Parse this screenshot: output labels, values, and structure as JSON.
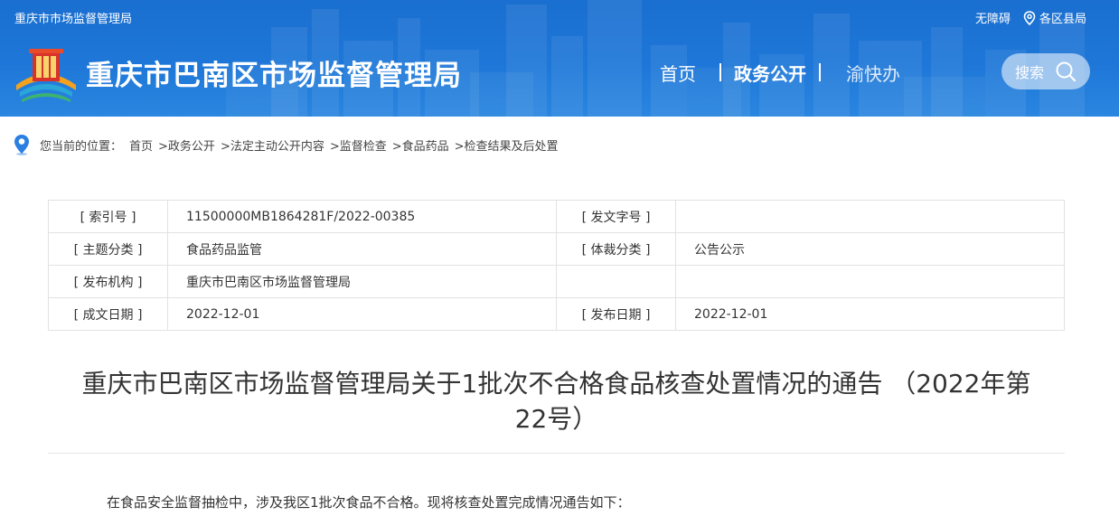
{
  "header": {
    "org_name": "重庆市市场监督管理局",
    "accessibility": "无障碍",
    "district_bureaus": "各区县局",
    "site_title": "重庆市巴南区市场监督管理局",
    "nav": [
      {
        "label": "首页"
      },
      {
        "label": "政务公开"
      },
      {
        "label": "渝快办"
      }
    ],
    "search_label": "搜索",
    "colors": {
      "header_bg": "#1e77d8",
      "text": "#ffffff"
    }
  },
  "breadcrumb": {
    "label": "您当前的位置：",
    "items": [
      "首页",
      ">政务公开",
      ">法定主动公开内容",
      ">监督检查",
      ">食品药品",
      ">检查结果及后处置"
    ]
  },
  "info": {
    "index_key": "[ 索引号 ]",
    "index_value": "11500000MB1864281F/2022-00385",
    "doc_no_key": "[ 发文字号 ]",
    "doc_no_value": "",
    "topic_key": "[ 主题分类 ]",
    "topic_value": "食品药品监管",
    "genre_key": "[ 体裁分类 ]",
    "genre_value": "公告公示",
    "publisher_key": "[ 发布机构 ]",
    "publisher_value": "重庆市巴南区市场监督管理局",
    "created_key": "[ 成文日期 ]",
    "created_value": "2022-12-01",
    "published_key": "[ 发布日期 ]",
    "published_value": "2022-12-01"
  },
  "article": {
    "title_line1": "重庆市巴南区市场监督管理局关于1批次不合格食品核查处置情况的通告 （2022年第",
    "title_line2": "22号）",
    "first_paragraph": "在食品安全监督抽检中，涉及我区1批次食品不合格。现将核查处置完成情况通告如下："
  }
}
